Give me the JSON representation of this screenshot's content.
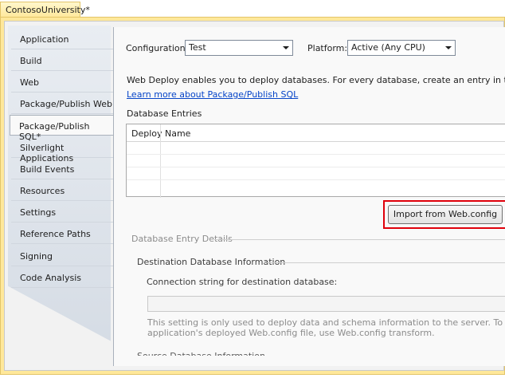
{
  "window": {
    "title": "ContosoUniversity*"
  },
  "sidebar": {
    "items": [
      {
        "label": "Application"
      },
      {
        "label": "Build"
      },
      {
        "label": "Web"
      },
      {
        "label": "Package/Publish Web"
      },
      {
        "label": "Package/Publish SQL*"
      },
      {
        "label": "Silverlight Applications"
      },
      {
        "label": "Build Events"
      },
      {
        "label": "Resources"
      },
      {
        "label": "Settings"
      },
      {
        "label": "Reference Paths"
      },
      {
        "label": "Signing"
      },
      {
        "label": "Code Analysis"
      }
    ],
    "selected": "Package/Publish SQL*"
  },
  "toolbar": {
    "configuration_label": "Configuration:",
    "configuration_value": "Test",
    "platform_label": "Platform:",
    "platform_value": "Active (Any CPU)"
  },
  "main": {
    "description": "Web Deploy enables you to deploy databases. For every database, create an entry in the grid below and",
    "learn_more_link": "Learn more about Package/Publish SQL",
    "database_entries_label": "Database Entries",
    "grid": {
      "columns": [
        "Deploy",
        "Name"
      ],
      "rows": []
    },
    "import_button": "Import from Web.config",
    "entry_details_label": "Database Entry Details",
    "destination_group_label": "Destination Database Information",
    "connection_string_label": "Connection string for destination database:",
    "connection_string_value": "",
    "note_line1": "This setting is only used to deploy data and schema information to the server. To change the conne",
    "note_line2": "application's deployed Web.config file, use Web.config transform.",
    "source_group_label_partial": "Source Database Information"
  },
  "colors": {
    "frame_accent": "#ffe89a",
    "highlight": "#e0000b",
    "link": "#0645c8"
  }
}
